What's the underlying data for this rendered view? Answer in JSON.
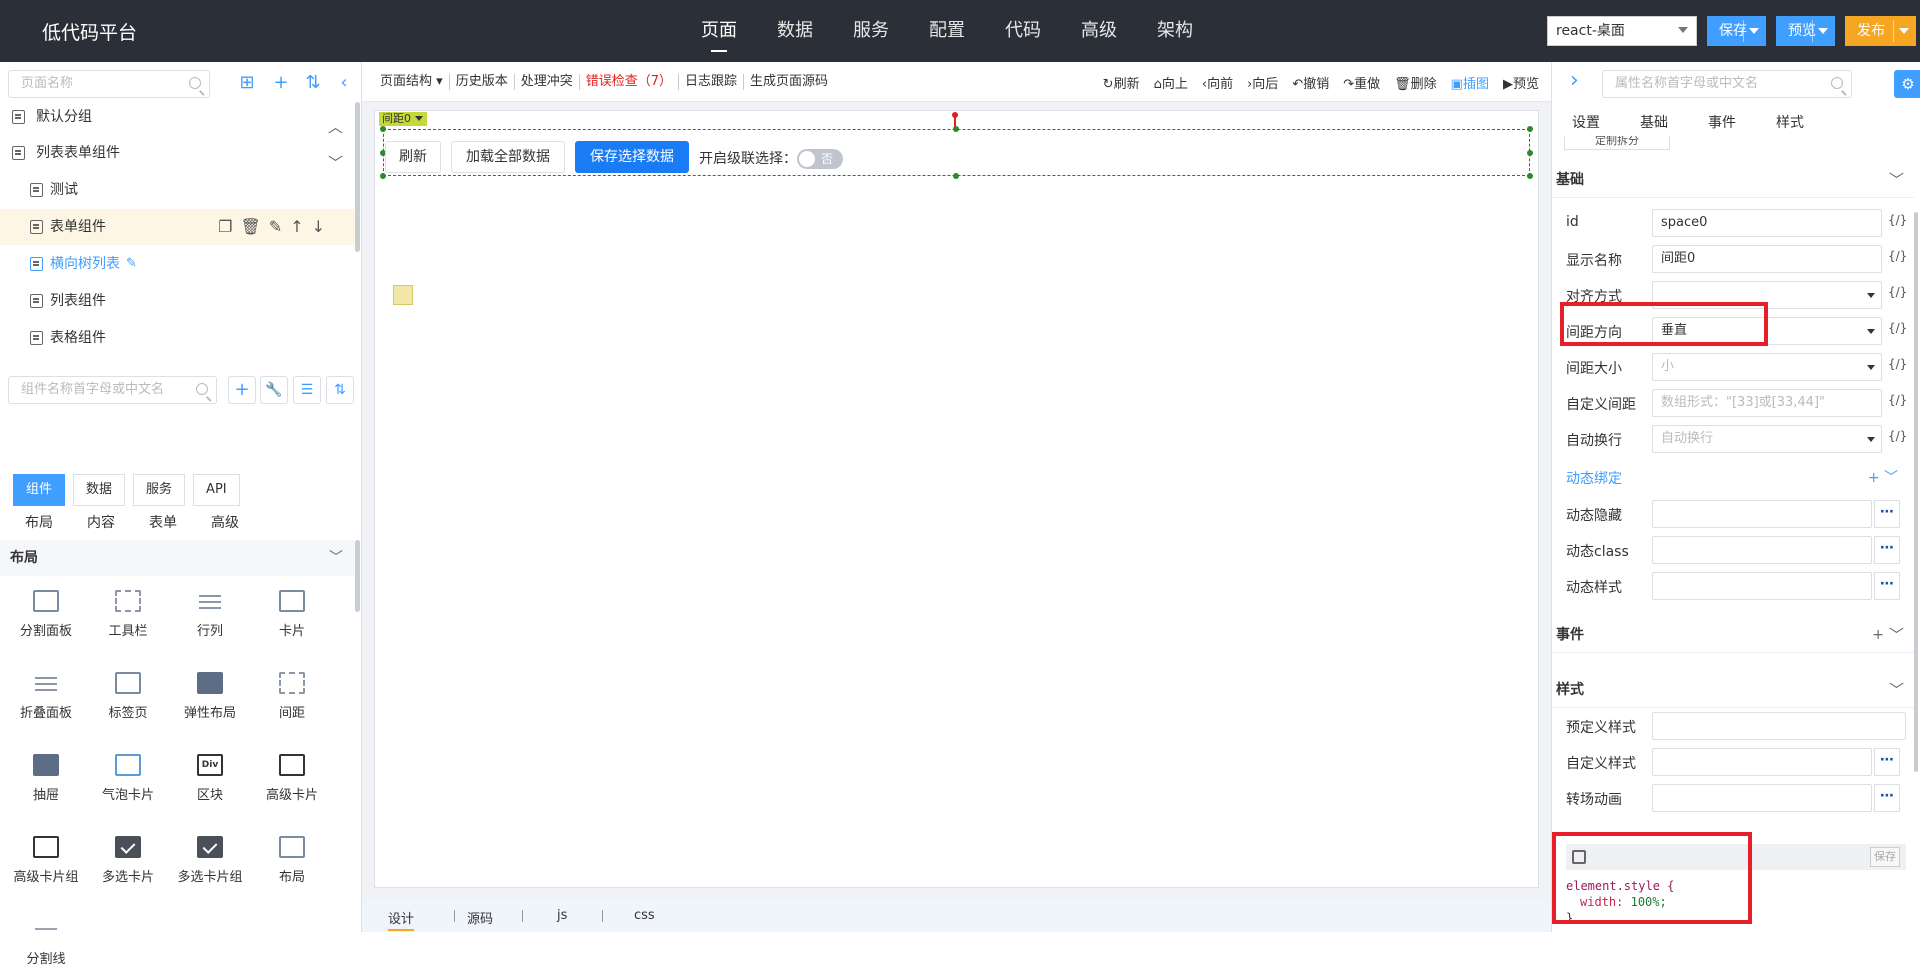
{
  "topbar": {
    "brand": "低代码平台",
    "nav": [
      "页面",
      "数据",
      "服务",
      "配置",
      "代码",
      "高级",
      "架构"
    ],
    "env": "react-桌面",
    "save": "保存",
    "preview": "预览",
    "publish": "发布"
  },
  "left": {
    "page_search_placeholder": "页面名称",
    "groups": [
      {
        "label": "默认分组"
      },
      {
        "label": "列表表单组件"
      }
    ],
    "pages": [
      "测试",
      "表单组件",
      "横向树列表",
      "列表组件",
      "表格组件"
    ],
    "comp_search_placeholder": "组件名称首字母或中文名",
    "tabs": [
      "组件",
      "数据",
      "服务",
      "API"
    ],
    "categories": [
      "布局",
      "内容",
      "表单",
      "高级"
    ],
    "section": "布局",
    "components": [
      "分割面板",
      "工具栏",
      "行列",
      "卡片",
      "折叠面板",
      "标签页",
      "弹性布局",
      "间距",
      "抽屉",
      "气泡卡片",
      "区块",
      "高级卡片",
      "高级卡片组",
      "多选卡片",
      "多选卡片组",
      "布局",
      "分割线"
    ],
    "div_icon_text": "Div"
  },
  "toolbar": {
    "left": [
      "页面结构",
      "历史版本",
      "处理冲突",
      "错误检查（7）",
      "日志跟踪",
      "生成页面源码"
    ],
    "right": [
      "刷新",
      "向上",
      "向前",
      "向后",
      "撤销",
      "重做",
      "删除",
      "插图",
      "预览"
    ]
  },
  "canvas": {
    "tag": "间距0",
    "buttons": [
      "刷新",
      "加载全部数据",
      "保存选择数据"
    ],
    "switch_label": "开启级联选择：",
    "switch_value": "否"
  },
  "bottom_tabs": [
    "设计",
    "源码",
    "js",
    "css"
  ],
  "right": {
    "search_placeholder": "属性名称首字母或中文名",
    "tabs": [
      "设置",
      "基础",
      "事件",
      "样式"
    ],
    "partial_button": "定制拆分",
    "section_basic": "基础",
    "props": [
      {
        "label": "id",
        "value": "space0"
      },
      {
        "label": "显示名称",
        "value": "间距0"
      },
      {
        "label": "对齐方式",
        "value": ""
      },
      {
        "label": "间距方向",
        "value": "垂直"
      },
      {
        "label": "间距大小",
        "value": "小"
      },
      {
        "label": "自定义间距",
        "value": "数组形式：\"[33]或[33,44]\""
      },
      {
        "label": "自动换行",
        "value": "自动换行"
      }
    ],
    "fx": "{/}",
    "dynamic": "动态绑定",
    "dynamic_props": [
      "动态隐藏",
      "动态class",
      "动态样式"
    ],
    "section_event": "事件",
    "section_style": "样式",
    "style_props": [
      "预定义样式",
      "自定义样式",
      "转场动画"
    ],
    "code_save": "保存",
    "code": {
      "selector": "element.style {",
      "prop": "width:",
      "val": "100%;",
      "close": "}"
    }
  }
}
